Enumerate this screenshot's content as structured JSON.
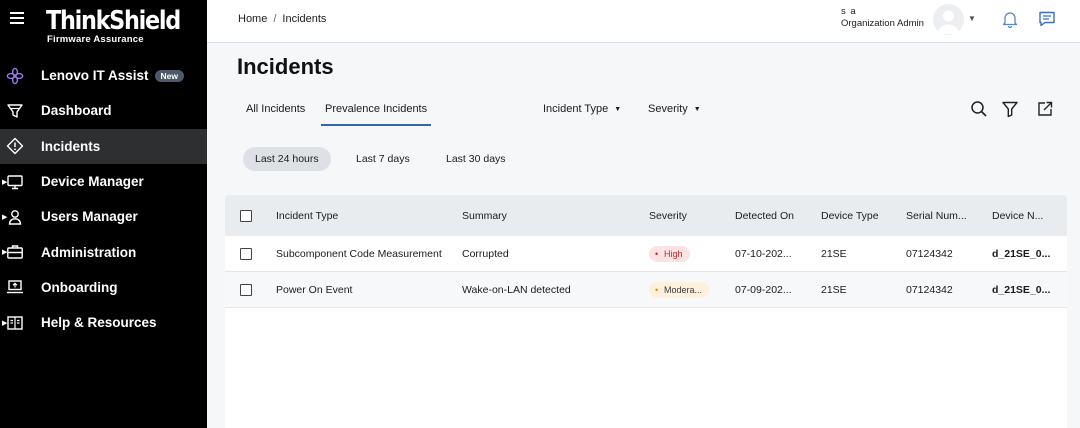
{
  "sidebar": {
    "logo_brand": "ThinkShield",
    "logo_sub": "Firmware Assurance",
    "items": [
      {
        "label": "Lenovo IT Assist",
        "badge": "New",
        "icon": "flower-icon"
      },
      {
        "label": "Dashboard",
        "icon": "funnel-chart-icon"
      },
      {
        "label": "Incidents",
        "icon": "alert-diamond-icon"
      },
      {
        "label": "Device Manager",
        "icon": "monitor-icon"
      },
      {
        "label": "Users Manager",
        "icon": "user-icon"
      },
      {
        "label": "Administration",
        "icon": "briefcase-icon"
      },
      {
        "label": "Onboarding",
        "icon": "laptop-upload-icon"
      },
      {
        "label": "Help & Resources",
        "icon": "book-icon"
      }
    ]
  },
  "breadcrumb": {
    "home": "Home",
    "separator": "/",
    "current": "Incidents"
  },
  "user": {
    "name": "s a",
    "role": "Organization Admin"
  },
  "page_title": "Incidents",
  "tabs": [
    {
      "label": "All Incidents",
      "active": false
    },
    {
      "label": "Prevalence Incidents",
      "active": true
    }
  ],
  "filters": {
    "incident_type": "Incident Type",
    "severity": "Severity"
  },
  "time_ranges": [
    {
      "label": "Last 24 hours",
      "active": true
    },
    {
      "label": "Last 7 days",
      "active": false
    },
    {
      "label": "Last 30 days",
      "active": false
    }
  ],
  "table": {
    "headers": [
      "Incident Type",
      "Summary",
      "Severity",
      "Detected On",
      "Device Type",
      "Serial Num...",
      "Device N..."
    ],
    "rows": [
      {
        "incident_type": "Subcomponent Code Measurement",
        "summary": "Corrupted",
        "severity": "High",
        "detected_on": "07-10-202...",
        "device_type": "21SE",
        "serial": "07124342",
        "device_name": "d_21SE_0..."
      },
      {
        "incident_type": "Power On Event",
        "summary": "Wake-on-LAN detected",
        "severity": "Modera...",
        "detected_on": "07-09-202...",
        "device_type": "21SE",
        "serial": "07124342",
        "device_name": "d_21SE_0..."
      }
    ]
  },
  "colors": {
    "sidebar_bg": "#000000",
    "active_nav": "#2e2f31",
    "tab_underline": "#3566a8",
    "high": "#c62828",
    "moderate": "#d08a12"
  }
}
